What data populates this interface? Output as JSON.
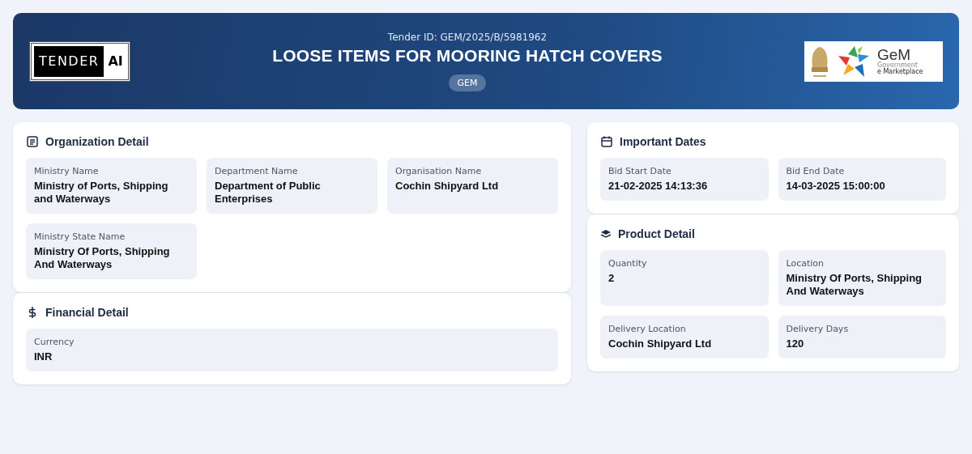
{
  "header": {
    "logo": {
      "left": "TENDER",
      "right": "AI"
    },
    "tender_id": "Tender ID: GEM/2025/B/5981962",
    "title": "LOOSE ITEMS FOR MOORING HATCH COVERS",
    "badge": "GEM",
    "partner_logo": {
      "name": "GeM",
      "line_1": "Government",
      "line_2": "e Marketplace"
    }
  },
  "columns": [
    [
      {
        "kind": "organization",
        "title": "Organization Detail",
        "fields": [
          {
            "label": "Ministry Name",
            "value": "Ministry of Ports, Shipping and Waterways"
          },
          {
            "label": "Department Name",
            "value": "Department of Public Enterprises"
          },
          {
            "label": "Organisation Name",
            "value": "Cochin Shipyard Ltd"
          },
          {
            "label": "Ministry State Name",
            "value": "Ministry Of Ports, Shipping And Waterways"
          }
        ]
      },
      {
        "kind": "financial",
        "title": "Financial Detail",
        "fields": [
          {
            "label": "Currency",
            "value": "INR"
          }
        ]
      }
    ],
    [
      {
        "kind": "dates",
        "title": "Important Dates",
        "fields": [
          {
            "label": "Bid Start Date",
            "value": "21-02-2025 14:13:36"
          },
          {
            "label": "Bid End Date",
            "value": "14-03-2025 15:00:00"
          }
        ]
      },
      {
        "kind": "product",
        "title": "Product Detail",
        "fields": [
          {
            "label": "Quantity",
            "value": "2"
          },
          {
            "label": "Location",
            "value": "Ministry Of Ports, Shipping And Waterways"
          },
          {
            "label": "Delivery Location",
            "value": "Cochin Shipyard Ltd"
          },
          {
            "label": "Delivery Days",
            "value": "120"
          }
        ]
      }
    ]
  ]
}
